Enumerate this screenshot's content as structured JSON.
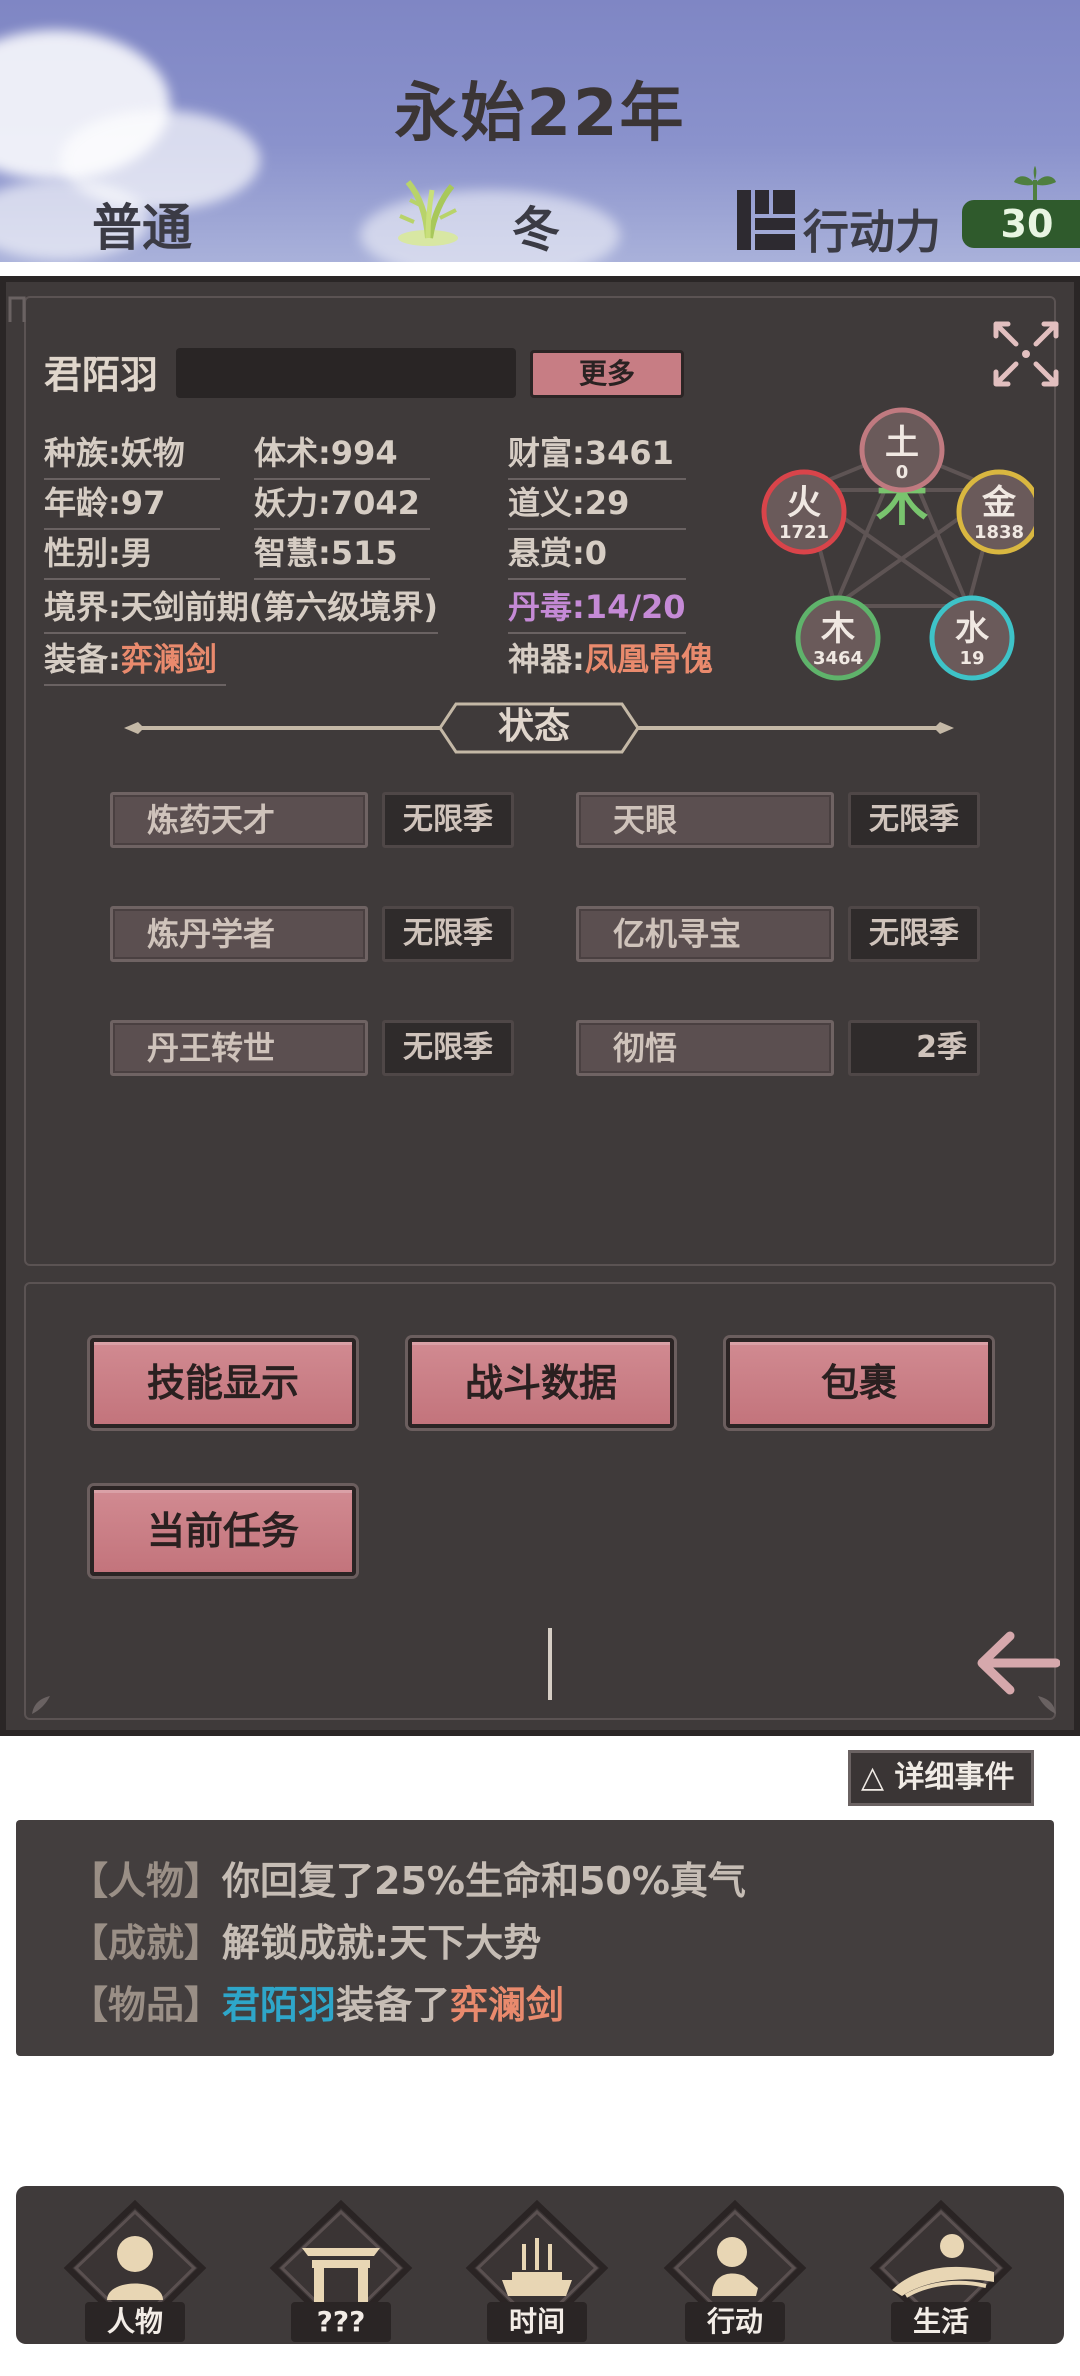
{
  "header": {
    "title": "永始22年",
    "difficulty": "普通",
    "season": "冬",
    "action_label": "行动力",
    "action_points": "30"
  },
  "character": {
    "name": "君陌羽",
    "more_label": "更多",
    "stats": {
      "race": "种族:妖物",
      "age": "年龄:97",
      "gender": "性别:男",
      "realm": "境界:天剑前期(第六级境界)",
      "equip_prefix": "装备:",
      "equip_value": "弈澜剑",
      "body": "体术:994",
      "demon_power": "妖力:7042",
      "wisdom": "智慧:515",
      "wealth": "财富:3461",
      "righteousness": "道义:29",
      "bounty": "悬赏:0",
      "pill_poison": "丹毒:14/20",
      "artifact_prefix": "神器:",
      "artifact_value": "凤凰骨傀"
    },
    "elements": {
      "center": "木",
      "earth": {
        "label": "土",
        "value": "0"
      },
      "metal": {
        "label": "金",
        "value": "1838"
      },
      "water": {
        "label": "水",
        "value": "19"
      },
      "wood": {
        "label": "木",
        "value": "3464"
      },
      "fire": {
        "label": "火",
        "value": "1721"
      }
    }
  },
  "status": {
    "title": "状态",
    "items": [
      {
        "name": "炼药天才",
        "duration": "无限季"
      },
      {
        "name": "天眼",
        "duration": "无限季"
      },
      {
        "name": "炼丹学者",
        "duration": "无限季"
      },
      {
        "name": "亿机寻宝",
        "duration": "无限季"
      },
      {
        "name": "丹王转世",
        "duration": "无限季"
      },
      {
        "name": "彻悟",
        "duration": "2季"
      }
    ]
  },
  "actions": {
    "skills": "技能显示",
    "battle": "战斗数据",
    "bag": "包裹",
    "quest": "当前任务"
  },
  "events": {
    "detail_label": "△ 详细事件",
    "lines": [
      {
        "tag": "【人物】",
        "text": "你回复了25%生命和50%真气"
      },
      {
        "tag": "【成就】",
        "text": "解锁成就:天下大势"
      },
      {
        "tag": "【物品】",
        "who": "君陌羽",
        "mid": "装备了",
        "item": "弈澜剑"
      }
    ]
  },
  "nav": {
    "items": [
      "人物",
      "???",
      "时间",
      "行动",
      "生活"
    ]
  },
  "colors": {
    "panel_bg": "#3f3a3a",
    "button_pink": "#c77d84",
    "highlight_orange": "#e98a6d",
    "poison_purple": "#c58ad6",
    "name_cyan": "#2ea6c9",
    "ap_green": "#2f5a2c"
  }
}
